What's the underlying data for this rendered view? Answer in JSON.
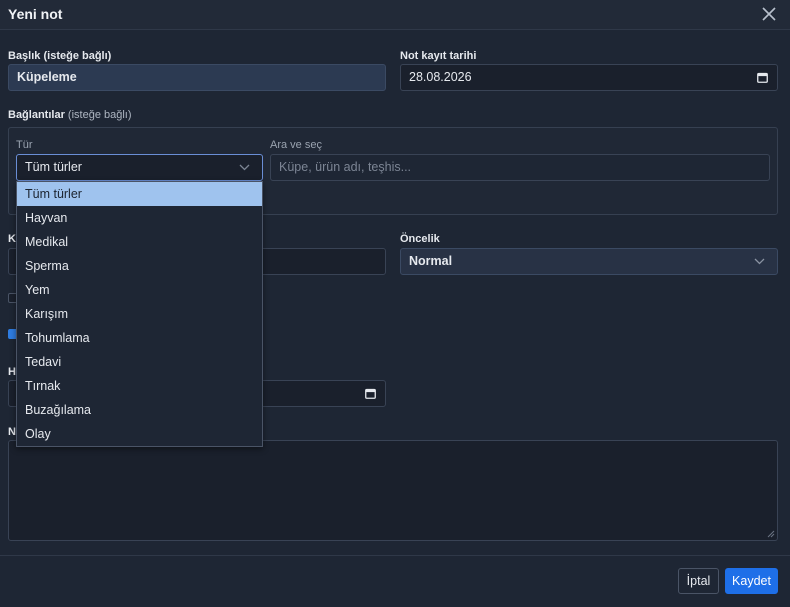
{
  "dialog": {
    "title": "Yeni not"
  },
  "form": {
    "title_label": "Başlık",
    "title_optional": "(isteğe bağlı)",
    "title_value": "Küpeleme",
    "date_label": "Not kayıt tarihi",
    "date_value": "28.08.2026",
    "links_label": "Bağlantılar",
    "links_optional": "(isteğe bağlı)",
    "type_label": "Tür",
    "type_value": "Tüm türler",
    "search_label": "Ara ve seç",
    "search_placeholder": "Küpe, ürün adı, teşhis...",
    "priority_label": "Öncelik",
    "priority_value": "Normal",
    "partial_label_k": "K",
    "partial_label_h": "H",
    "partial_label_n": "N"
  },
  "type_options": [
    "Tüm türler",
    "Hayvan",
    "Medikal",
    "Sperma",
    "Yem",
    "Karışım",
    "Tohumlama",
    "Tedavi",
    "Tırnak",
    "Buzağılama",
    "Olay"
  ],
  "footer": {
    "cancel_label": "İptal",
    "save_label": "Kaydet"
  },
  "colors": {
    "primary": "#1e6fe8",
    "selected_option": "#9fc3ee",
    "background": "#1e2634"
  }
}
